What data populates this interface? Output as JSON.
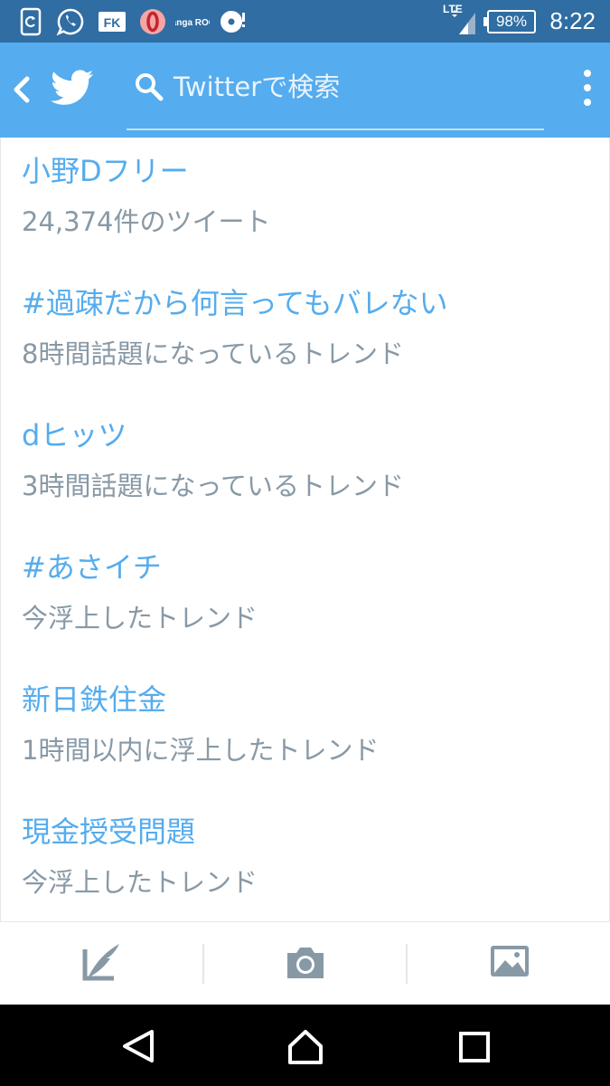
{
  "status_bar": {
    "time": "8:22",
    "battery": "98%",
    "network": "LTE",
    "notification_icons": [
      "refresh-app-icon",
      "whatsapp-icon",
      "fk-app-icon",
      "opera-icon",
      "manga-rock-icon",
      "music-icon"
    ],
    "manga_rock_label": "manga ROCK",
    "fk_label": "FK"
  },
  "app_bar": {
    "color": "#55acee",
    "search_placeholder": "Twitterで検索"
  },
  "trends": [
    {
      "title": "小野Dフリー",
      "meta": "24,374件のツイート"
    },
    {
      "title": "#過疎だから何言ってもバレない",
      "meta": "8時間話題になっているトレンド"
    },
    {
      "title": "dヒッツ",
      "meta": "3時間話題になっているトレンド"
    },
    {
      "title": "#あさイチ",
      "meta": "今浮上したトレンド"
    },
    {
      "title": "新日鉄住金",
      "meta": "1時間以内に浮上したトレンド"
    },
    {
      "title": "現金授受問題",
      "meta": "今浮上したトレンド"
    }
  ],
  "toolbar": {
    "icons": [
      "compose-icon",
      "camera-icon",
      "gallery-icon"
    ]
  },
  "navigation": {
    "icons": [
      "back-triangle-icon",
      "home-icon",
      "recents-icon"
    ]
  }
}
